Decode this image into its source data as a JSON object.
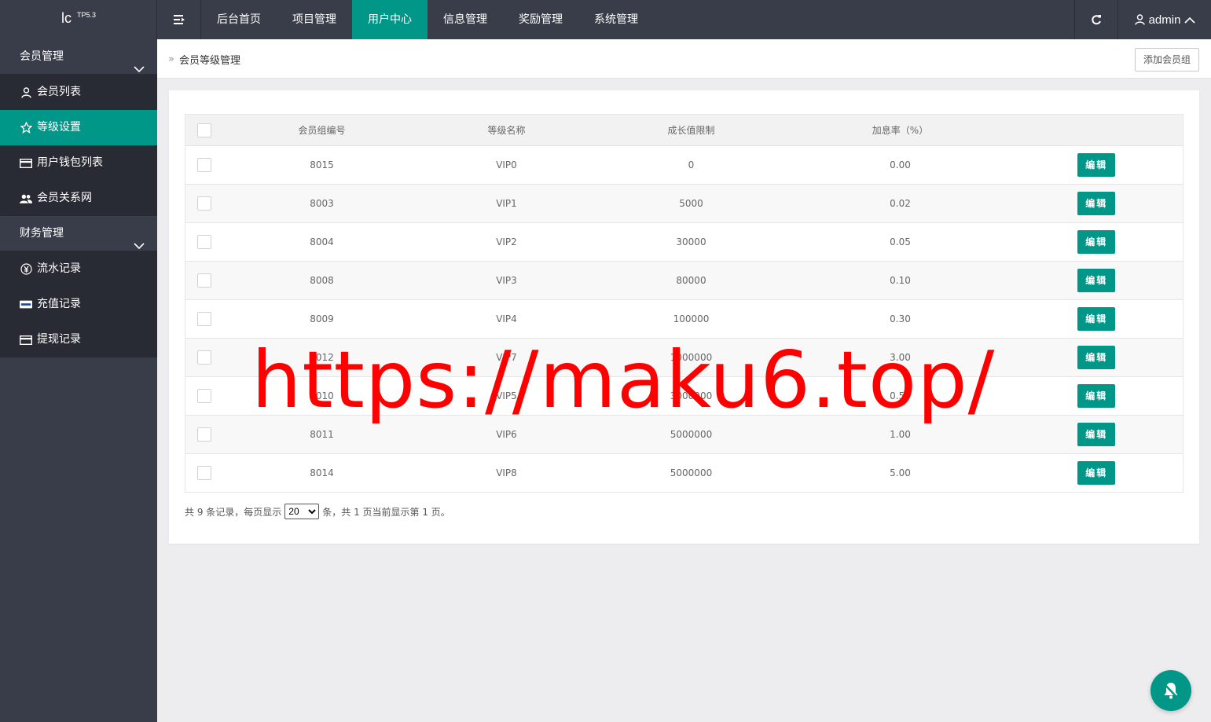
{
  "app": {
    "logo_main": "lc",
    "logo_sup": "TP5.3"
  },
  "header": {
    "nav": [
      {
        "label": "后台首页"
      },
      {
        "label": "项目管理"
      },
      {
        "label": "用户中心",
        "active": true
      },
      {
        "label": "信息管理"
      },
      {
        "label": "奖励管理"
      },
      {
        "label": "系统管理"
      }
    ],
    "user": "admin"
  },
  "sidebar": {
    "groups": [
      {
        "label": "会员管理",
        "items": [
          {
            "label": "会员列表",
            "icon": "user-icon"
          },
          {
            "label": "等级设置",
            "icon": "star-icon",
            "active": true
          },
          {
            "label": "用户钱包列表",
            "icon": "card-icon"
          },
          {
            "label": "会员关系网",
            "icon": "users-icon"
          }
        ]
      },
      {
        "label": "财务管理",
        "items": [
          {
            "label": "流水记录",
            "icon": "yen-icon"
          },
          {
            "label": "充值记录",
            "icon": "paypal-card-icon"
          },
          {
            "label": "提现记录",
            "icon": "card-icon"
          }
        ]
      }
    ]
  },
  "breadcrumb": {
    "title": "会员等级管理"
  },
  "toolbar": {
    "add_label": "添加会员组"
  },
  "table": {
    "headers": [
      "会员组编号",
      "等级名称",
      "成长值限制",
      "加息率（%）"
    ],
    "edit_label": "编辑",
    "rows": [
      [
        "8015",
        "VIP0",
        "0",
        "0.00"
      ],
      [
        "8003",
        "VIP1",
        "5000",
        "0.02"
      ],
      [
        "8004",
        "VIP2",
        "30000",
        "0.05"
      ],
      [
        "8008",
        "VIP3",
        "80000",
        "0.10"
      ],
      [
        "8009",
        "VIP4",
        "100000",
        "0.30"
      ],
      [
        "8012",
        "VIP7",
        "1000000",
        "3.00"
      ],
      [
        "8010",
        "VIP5",
        "3000000",
        "0.50"
      ],
      [
        "8011",
        "VIP6",
        "5000000",
        "1.00"
      ],
      [
        "8014",
        "VIP8",
        "5000000",
        "5.00"
      ]
    ]
  },
  "pager": {
    "prefix": "共 9 条记录，每页显示",
    "per_page": "20",
    "suffix": "条，共 1 页当前显示第 1 页。"
  },
  "watermark": "https://maku6.top/",
  "colors": {
    "accent": "#009688",
    "header_bg": "#393d49",
    "watermark": "#ff0000"
  }
}
